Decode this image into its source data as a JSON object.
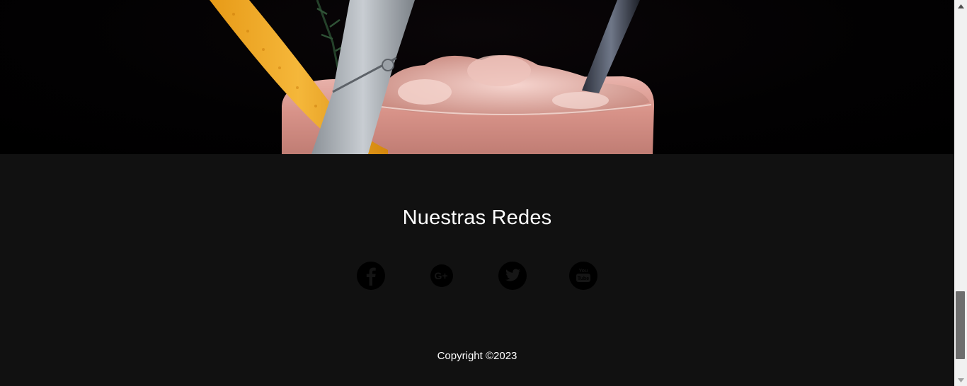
{
  "hero": {
    "image_alt": "cocktail-photo"
  },
  "footer": {
    "title": "Nuestras Redes",
    "socials": [
      {
        "name": "facebook",
        "icon": "facebook-icon",
        "glyph": "f"
      },
      {
        "name": "google-plus",
        "icon": "google-plus-icon",
        "glyph": "G+"
      },
      {
        "name": "twitter",
        "icon": "twitter-icon",
        "glyph": "bird"
      },
      {
        "name": "youtube",
        "icon": "youtube-icon",
        "glyph": "You Tube"
      }
    ],
    "copyright": "Copyright ©2023"
  },
  "scrollbar": {
    "position": 0.95
  },
  "colors": {
    "footer_bg": "#111111",
    "icon_circle": "#000000",
    "text": "#ffffff"
  }
}
